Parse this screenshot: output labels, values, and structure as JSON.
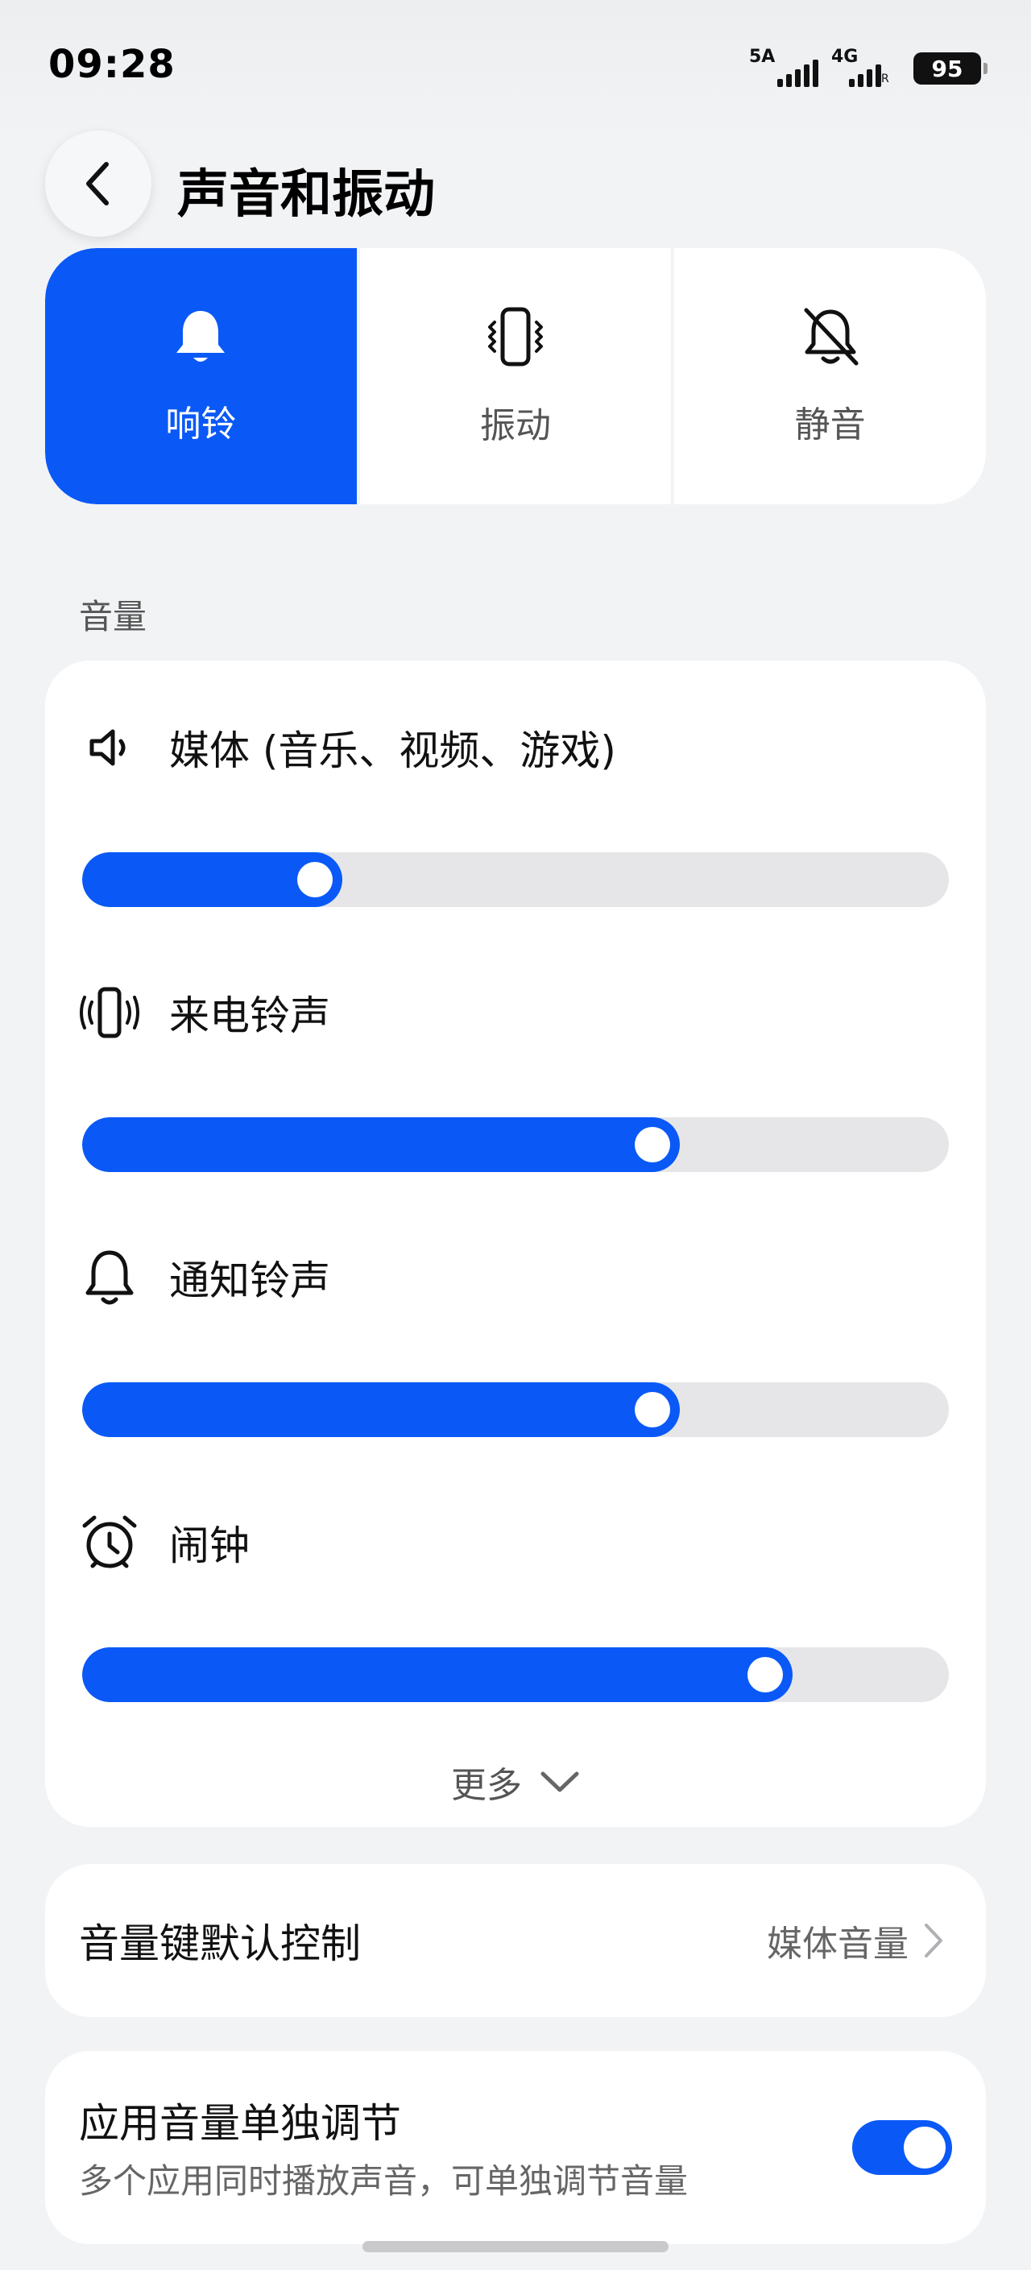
{
  "status_bar": {
    "time": "09:28",
    "network_1": "5A",
    "network_2": "4G",
    "network_2_sub": "R",
    "battery": "95"
  },
  "header": {
    "title": "声音和振动",
    "back_icon": "chevron-left-icon"
  },
  "modes": [
    {
      "label": "响铃",
      "icon": "bell-icon",
      "active": true
    },
    {
      "label": "振动",
      "icon": "phone-vibrate-icon",
      "active": false
    },
    {
      "label": "静音",
      "icon": "bell-off-icon",
      "active": false
    }
  ],
  "volume": {
    "section_label": "音量",
    "items": [
      {
        "label": "媒体 (音乐、视频、游戏)",
        "icon": "speaker-icon",
        "level": 0.3
      },
      {
        "label": "来电铃声",
        "icon": "phone-vibrate-icon",
        "level": 0.69
      },
      {
        "label": "通知铃声",
        "icon": "bell-icon",
        "level": 0.69
      },
      {
        "label": "闹钟",
        "icon": "alarm-clock-icon",
        "level": 0.82
      }
    ],
    "more_label": "更多"
  },
  "volume_key": {
    "title": "音量键默认控制",
    "value": "媒体音量"
  },
  "app_volume": {
    "title": "应用音量单独调节",
    "description": "多个应用同时播放声音，可单独调节音量",
    "enabled": true
  },
  "colors": {
    "accent": "#0a59f7",
    "background": "#f1f3f5",
    "card": "#ffffff",
    "track": "#e6e6e8"
  }
}
